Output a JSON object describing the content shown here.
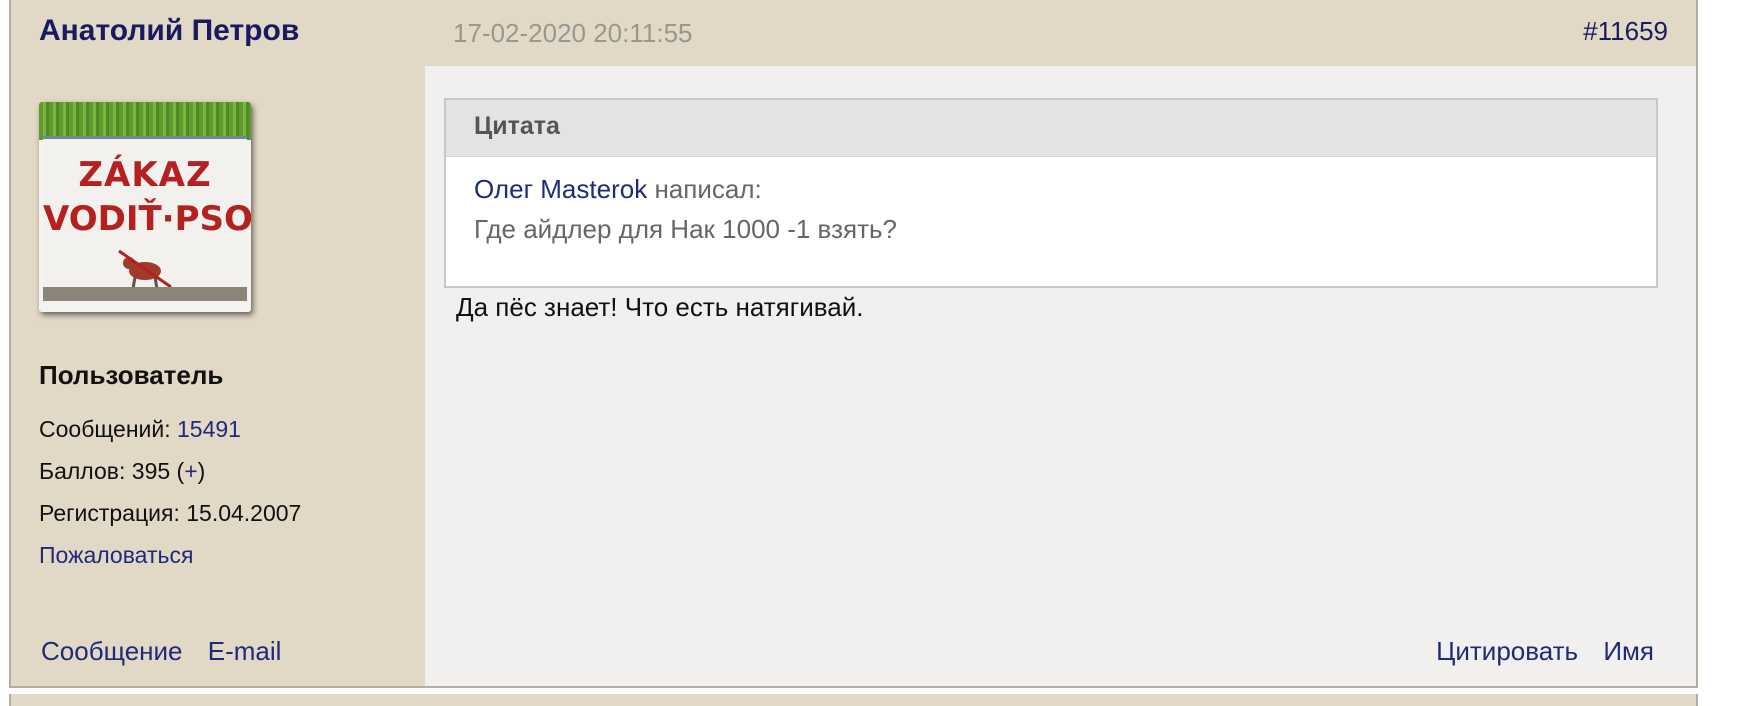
{
  "post": {
    "author": "Анатолий Петров",
    "date": "17-02-2020 20:11:55",
    "number": "#11659",
    "body": "Да пёс знает! Что есть натягивай."
  },
  "avatar": {
    "line1": "ZÁKAZ",
    "line2": "VODIŤ·PSOV!"
  },
  "profile": {
    "role": "Пользователь",
    "posts_label": "Сообщений:",
    "posts_value": "15491",
    "points_label": "Баллов:",
    "points_value": "395",
    "points_add": "+",
    "reg_label": "Регистрация:",
    "reg_value": "15.04.2007",
    "complain": "Пожаловаться"
  },
  "quote": {
    "title": "Цитата",
    "author": "Олег Masterok",
    "wrote": "написал:",
    "text": "Где айдлер для Нак 1000 -1 взять?"
  },
  "actions": {
    "message": "Сообщение",
    "email": "E-mail",
    "cite": "Цитировать",
    "name": "Имя"
  },
  "colors": {
    "sidebar_bg": "#e2d8c6",
    "content_bg": "#f1f0ee",
    "link": "#1f2a7a",
    "author_name": "#1a1a60"
  }
}
